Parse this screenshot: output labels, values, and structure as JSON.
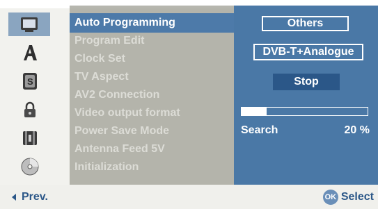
{
  "menu": {
    "items": [
      {
        "label": "Auto Programming",
        "active": true
      },
      {
        "label": "Program Edit",
        "active": false
      },
      {
        "label": "Clock Set",
        "active": false
      },
      {
        "label": "TV Aspect",
        "active": false
      },
      {
        "label": "AV2 Connection",
        "active": false
      },
      {
        "label": "Video output format",
        "active": false
      },
      {
        "label": "Power Save Mode",
        "active": false
      },
      {
        "label": "Antenna Feed 5V",
        "active": false
      },
      {
        "label": "Initialization",
        "active": false
      }
    ]
  },
  "sidebar": {
    "icons": [
      {
        "name": "tv-setup-icon",
        "selected": true
      },
      {
        "name": "language-icon",
        "selected": false
      },
      {
        "name": "audio-icon",
        "selected": false
      },
      {
        "name": "lock-icon",
        "selected": false
      },
      {
        "name": "record-icon",
        "selected": false
      },
      {
        "name": "disc-icon",
        "selected": false
      }
    ]
  },
  "panel": {
    "country_label": "Others",
    "source_label": "DVB-T+Analogue",
    "stop_label": "Stop",
    "progress_fraction": 0.2,
    "search_label": "Search",
    "search_percent": "20 %"
  },
  "footer": {
    "prev_label": "Prev.",
    "ok_label": "OK",
    "select_label": "Select"
  },
  "colors": {
    "accent": "#4a78a6",
    "menu_bg": "#b4b4ab",
    "dark_button": "#2b5788"
  }
}
